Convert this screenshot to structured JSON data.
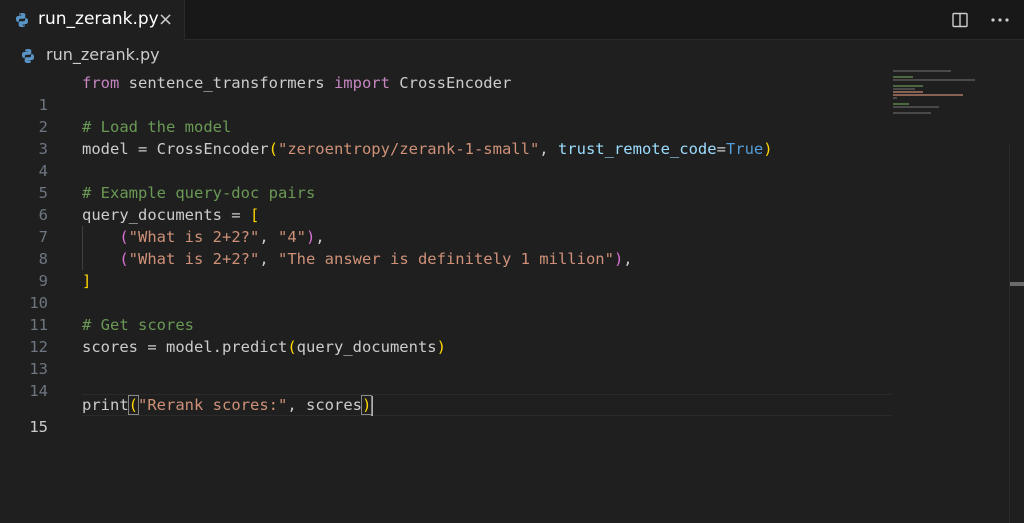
{
  "tab": {
    "filename": "run_zerank.py",
    "close_icon": "×"
  },
  "breadcrumb": {
    "filename": "run_zerank.py"
  },
  "editor": {
    "active_line": 15,
    "lines": [
      {
        "n": "1"
      },
      {
        "n": "2"
      },
      {
        "n": "3"
      },
      {
        "n": "4"
      },
      {
        "n": "5"
      },
      {
        "n": "6"
      },
      {
        "n": "7"
      },
      {
        "n": "8"
      },
      {
        "n": "9"
      },
      {
        "n": "10"
      },
      {
        "n": "11"
      },
      {
        "n": "12"
      },
      {
        "n": "13"
      },
      {
        "n": "14"
      },
      {
        "n": "15"
      }
    ],
    "code": {
      "l1_from": "from",
      "l1_mod": " sentence_transformers ",
      "l1_import": "import",
      "l1_cls": " CrossEncoder",
      "l3": "# Load the model",
      "l4_a": "model = CrossEncoder",
      "l4_open": "(",
      "l4_str": "\"zeroentropy/zerank-1-small\"",
      "l4_comma": ", ",
      "l4_param": "trust_remote_code",
      "l4_eq": "=",
      "l4_true": "True",
      "l4_close": ")",
      "l6": "# Example query-doc pairs",
      "l7_a": "query_documents = ",
      "l7_open": "[",
      "l8_indent": "    ",
      "l8_open": "(",
      "l8_s1": "\"What is 2+2?\"",
      "l8_comma": ", ",
      "l8_s2": "\"4\"",
      "l8_close": ")",
      "l8_end": ",",
      "l9_indent": "    ",
      "l9_open": "(",
      "l9_s1": "\"What is 2+2?\"",
      "l9_comma": ", ",
      "l9_s2": "\"The answer is definitely 1 million\"",
      "l9_close": ")",
      "l9_end": ",",
      "l10_close": "]",
      "l12": "# Get scores",
      "l13_a": "scores = model.predict",
      "l13_open": "(",
      "l13_b": "query_documents",
      "l13_close": ")",
      "l15_fn": "print",
      "l15_open": "(",
      "l15_str": "\"Rerank scores:\"",
      "l15_b": ", scores",
      "l15_close": ")"
    }
  },
  "icons": {
    "python": "python-file-icon",
    "split": "split-editor-icon",
    "more": "more-actions-icon"
  },
  "colors": {
    "background": "#1f1f1f",
    "keyword": "#c586c0",
    "comment": "#6a9955",
    "string": "#ce9178",
    "param": "#9cdcfe",
    "bool": "#569cd6",
    "bracket": "#ffd700"
  }
}
